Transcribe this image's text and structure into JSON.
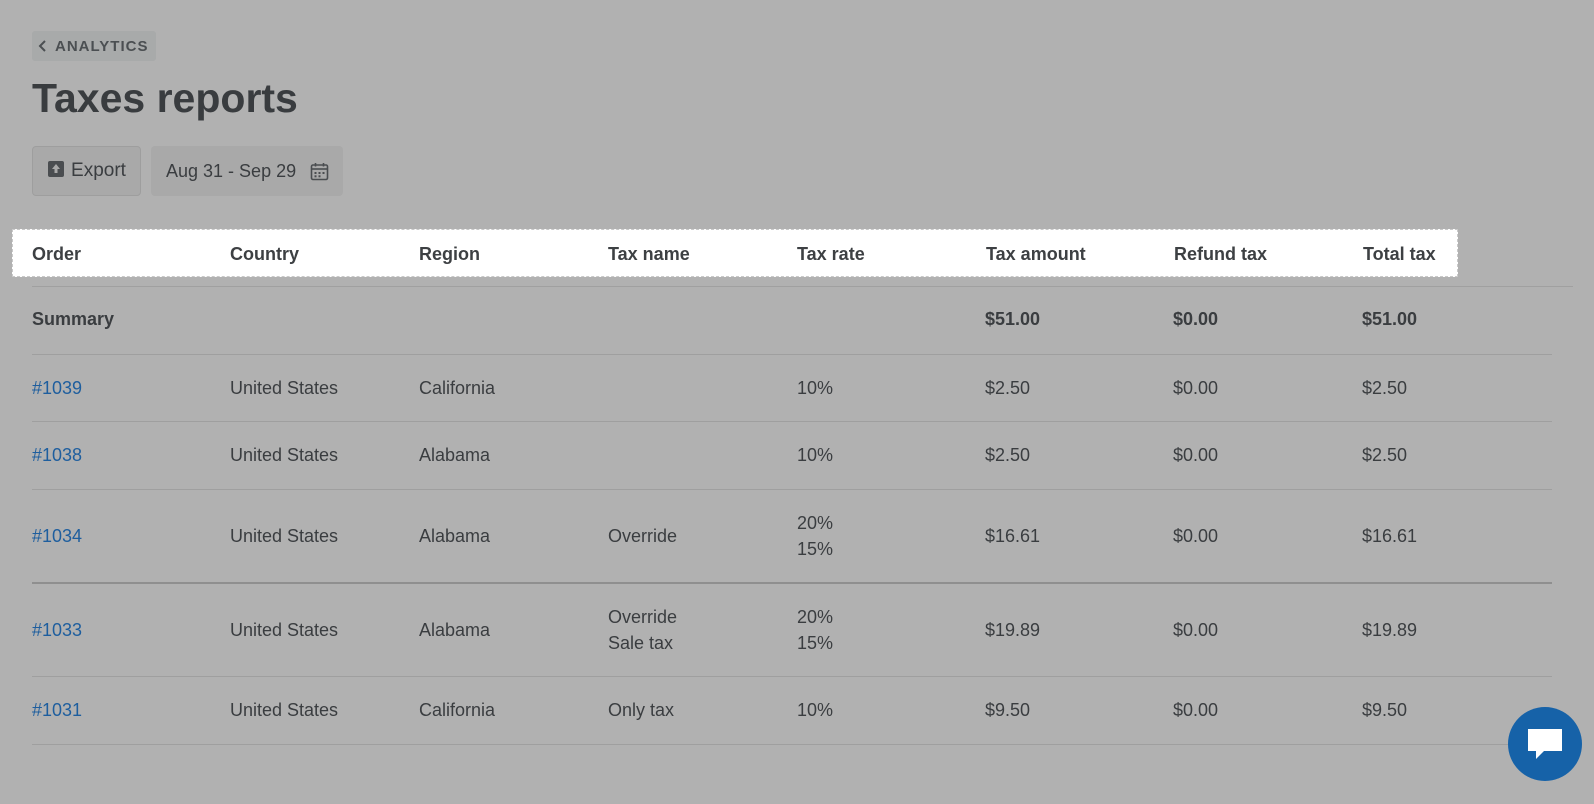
{
  "nav": {
    "back_label": "ANALYTICS",
    "back_icon": "chevron-left-icon"
  },
  "page": {
    "title": "Taxes reports"
  },
  "toolbar": {
    "export_label": "Export",
    "export_icon": "export-icon",
    "date_range": "Aug 31 - Sep 29",
    "calendar_icon": "calendar-icon"
  },
  "table": {
    "headers": [
      "Order",
      "Country",
      "Region",
      "Tax name",
      "Tax rate",
      "Tax amount",
      "Refund tax",
      "Total tax"
    ],
    "summary": {
      "label": "Summary",
      "tax_amount": "$51.00",
      "refund_tax": "$0.00",
      "total_tax": "$51.00"
    },
    "rows": [
      {
        "order": "#1039",
        "country": "United States",
        "region": "California",
        "tax_names": [],
        "tax_rates": [
          "10%"
        ],
        "tax_amount": "$2.50",
        "refund_tax": "$0.00",
        "total_tax": "$2.50"
      },
      {
        "order": "#1038",
        "country": "United States",
        "region": "Alabama",
        "tax_names": [],
        "tax_rates": [
          "10%"
        ],
        "tax_amount": "$2.50",
        "refund_tax": "$0.00",
        "total_tax": "$2.50"
      },
      {
        "order": "#1034",
        "country": "United States",
        "region": "Alabama",
        "tax_names": [
          "Override"
        ],
        "tax_rates": [
          "20%",
          "15%"
        ],
        "tax_amount": "$16.61",
        "refund_tax": "$0.00",
        "total_tax": "$16.61"
      },
      {
        "order": "#1033",
        "country": "United States",
        "region": "Alabama",
        "tax_names": [
          "Override",
          "Sale tax"
        ],
        "tax_rates": [
          "20%",
          "15%"
        ],
        "tax_amount": "$19.89",
        "refund_tax": "$0.00",
        "total_tax": "$19.89"
      },
      {
        "order": "#1031",
        "country": "United States",
        "region": "California",
        "tax_names": [
          "Only tax"
        ],
        "tax_rates": [
          "10%"
        ],
        "tax_amount": "$9.50",
        "refund_tax": "$0.00",
        "total_tax": "$9.50"
      }
    ]
  },
  "chat": {
    "icon": "chat-bubble-icon"
  },
  "colors": {
    "overlay_background": "#b1b1b1",
    "link": "#1e5e9e",
    "chat_button": "#1662a8",
    "highlight": "#ffffff"
  }
}
